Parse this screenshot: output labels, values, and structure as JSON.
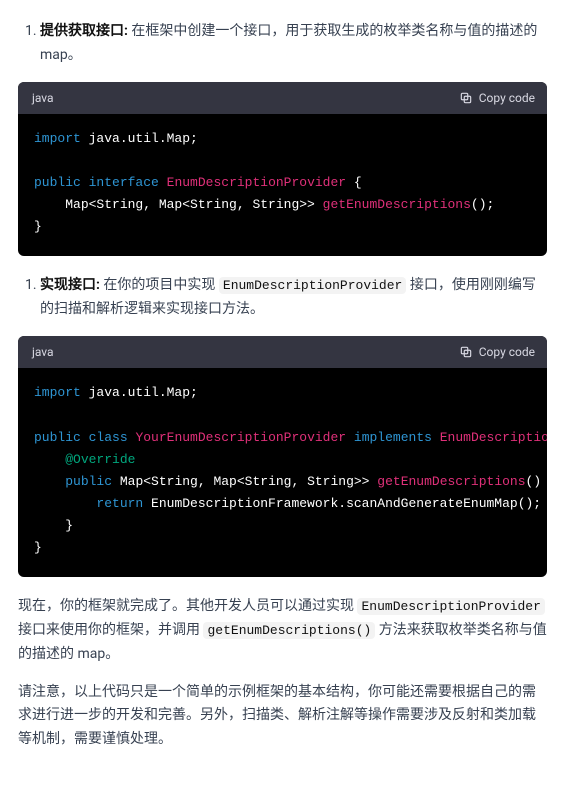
{
  "items": [
    {
      "number": "1.",
      "title": "提供获取接口:",
      "text_parts": {
        "a": " 在框架中创建一个接口，用于获取生成的枚举类名称与值的描述的 ",
        "b": "map。"
      }
    },
    {
      "number": "1.",
      "title": "实现接口:",
      "text_parts": {
        "a": " 在你的项目中实现 ",
        "code": "EnumDescriptionProvider",
        "b": " 接口，使用刚刚编写的扫描和解析逻辑来实现接口方法。"
      }
    }
  ],
  "code": {
    "lang": "java",
    "copy": "Copy code",
    "block1": {
      "l1": {
        "kw": "import",
        "rest": " java.util.Map;"
      },
      "l2": {
        "kw1": "public",
        "kw2": "interface",
        "cls": "EnumDescriptionProvider",
        "rest": " {"
      },
      "l3": {
        "indent": "    ",
        "type": "Map<String, Map<String, String>>",
        "mth": "getEnumDescriptions",
        "tail": "();"
      },
      "l4": {
        "text": "}"
      }
    },
    "block2": {
      "l1": {
        "kw": "import",
        "rest": " java.util.Map;"
      },
      "l2": {
        "kw1": "public",
        "kw2": "class",
        "cls1": "YourEnumDescriptionProvider",
        "kw3": "implements",
        "cls2": "EnumDescriptionProvid"
      },
      "l3": {
        "indent": "    ",
        "ann": "@Override"
      },
      "l4": {
        "indent": "    ",
        "kw": "public",
        "type": "Map<String, Map<String, String>>",
        "mth": "getEnumDescriptions",
        "tail": "() {"
      },
      "l5": {
        "indent": "        ",
        "kw": "return",
        "rest": " EnumDescriptionFramework.scanAndGenerateEnumMap();"
      },
      "l6": {
        "indent": "    ",
        "text": "}"
      },
      "l7": {
        "text": "}"
      }
    }
  },
  "paras": {
    "p1": {
      "a": "现在，你的框架就完成了。其他开发人员可以通过实现 ",
      "c1": "EnumDescriptionProvider",
      "b": " 接口来使用你的框架，并调用 ",
      "c2": "getEnumDescriptions()",
      "c": " 方法来获取枚举类名称与值的描述的 map。"
    },
    "p2": "请注意，以上代码只是一个简单的示例框架的基本结构，你可能还需要根据自己的需求进行进一步的开发和完善。另外，扫描类、解析注解等操作需要涉及反射和类加载等机制，需要谨慎处理。"
  }
}
